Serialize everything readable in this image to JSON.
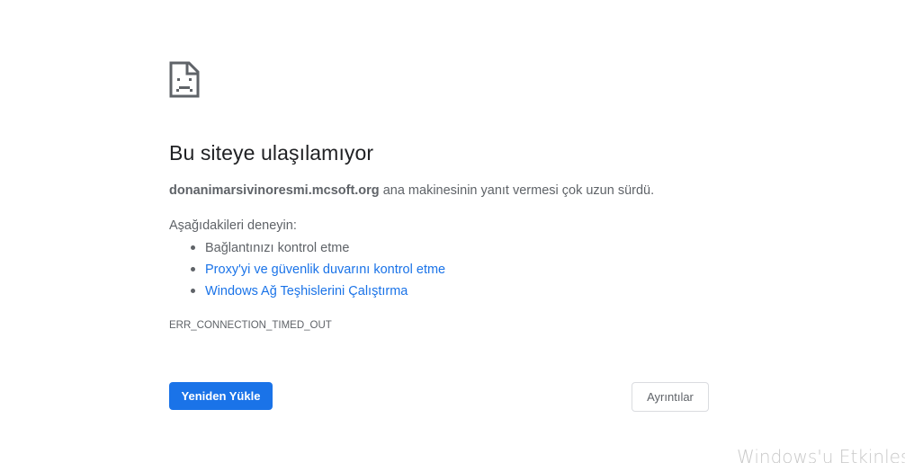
{
  "error_page": {
    "icon": "sad-document-icon",
    "title": "Bu siteye ulaşılamıyor",
    "summary_host": "donanimarsivinoresmi.mcsoft.org",
    "summary_text": " ana makinesinin yanıt vermesi çok uzun sürdü.",
    "try_heading": "Aşağıdakileri deneyin:",
    "suggestions": [
      {
        "label": "Bağlantınızı kontrol etme"
      },
      {
        "label": "Proxy'yi ve güvenlik duvarını kontrol etme"
      },
      {
        "label": "Windows Ağ Teşhislerini Çalıştırma"
      }
    ],
    "error_code": "ERR_CONNECTION_TIMED_OUT",
    "reload_label": "Yeniden Yükle",
    "details_label": "Ayrıntılar"
  },
  "watermark": {
    "text": "Windows'u Etkinleştir"
  },
  "colors": {
    "accent": "#1a73e8",
    "text": "#202124",
    "secondary_text": "#5f6368",
    "border": "#dadce0",
    "watermark": "#c8c8c8"
  }
}
